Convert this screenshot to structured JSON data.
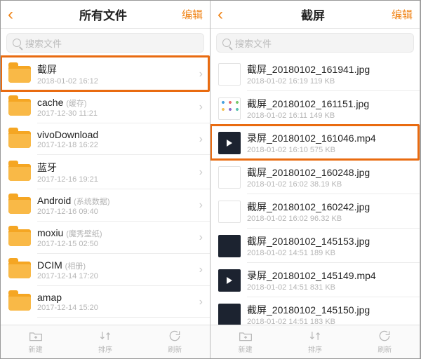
{
  "accent": "#f08519",
  "left": {
    "title": "所有文件",
    "edit": "编辑",
    "search_placeholder": "搜索文件",
    "items": [
      {
        "name": "截屏",
        "note": "",
        "sub": "2018-01-02 16:12",
        "highlight": true
      },
      {
        "name": "cache",
        "note": "(缓存)",
        "sub": "2017-12-30 11:21"
      },
      {
        "name": "vivoDownload",
        "note": "",
        "sub": "2017-12-18 16:22"
      },
      {
        "name": "蓝牙",
        "note": "",
        "sub": "2017-12-16 19:21"
      },
      {
        "name": "Android",
        "note": "(系统数据)",
        "sub": "2017-12-16 09:40"
      },
      {
        "name": "moxiu",
        "note": "(魔秀壁纸)",
        "sub": "2017-12-15 02:50"
      },
      {
        "name": "DCIM",
        "note": "(相册)",
        "sub": "2017-12-14 17:20"
      },
      {
        "name": "amap",
        "note": "",
        "sub": "2017-12-14 15:20"
      }
    ],
    "toolbar": {
      "new": "新建",
      "sort": "排序",
      "refresh": "刷新"
    }
  },
  "right": {
    "title": "截屏",
    "edit": "编辑",
    "search_placeholder": "搜索文件",
    "items": [
      {
        "name": "截屏_20180102_161941.jpg",
        "sub": "2018-01-02 16:19   119 KB",
        "thumb": "light"
      },
      {
        "name": "截屏_20180102_161151.jpg",
        "sub": "2018-01-02 16:11   149 KB",
        "thumb": "icons"
      },
      {
        "name": "录屏_20180102_161046.mp4",
        "sub": "2018-01-02 16:10   575 KB",
        "thumb": "dark",
        "video": true,
        "highlight": true
      },
      {
        "name": "截屏_20180102_160248.jpg",
        "sub": "2018-01-02 16:02   38.19 KB",
        "thumb": "light"
      },
      {
        "name": "截屏_20180102_160242.jpg",
        "sub": "2018-01-02 16:02   96.32 KB",
        "thumb": "light"
      },
      {
        "name": "截屏_20180102_145153.jpg",
        "sub": "2018-01-02 14:51   189 KB",
        "thumb": "dark"
      },
      {
        "name": "录屏_20180102_145149.mp4",
        "sub": "2018-01-02 14:51   831 KB",
        "thumb": "dark",
        "video": true
      },
      {
        "name": "截屏_20180102_145150.jpg",
        "sub": "2018-01-02 14:51   183 KB",
        "thumb": "dark"
      }
    ],
    "toolbar": {
      "new": "新建",
      "sort": "排序",
      "refresh": "刷新"
    }
  }
}
